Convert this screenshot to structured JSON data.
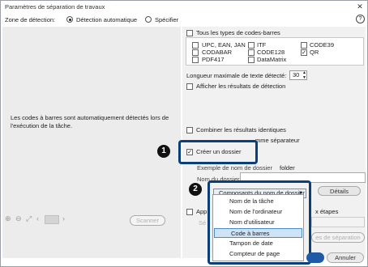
{
  "window": {
    "title": "Paramètres de séparation de travaux",
    "close_glyph": "✕",
    "help_glyph": "?"
  },
  "mode": {
    "label": "Zone de détection:",
    "options": [
      {
        "label": "Détection automatique",
        "selected": true
      },
      {
        "label": "Spécifier",
        "selected": false
      }
    ]
  },
  "left_pane": {
    "message": "Les codes à barres sont automatiquement détectés lors de l'exécution de la tâche.",
    "toolbar_icons": [
      "zoom-in-icon",
      "zoom-out-icon",
      "fit-icon",
      "prev-page-icon",
      "page-thumbnail-icon",
      "next-page-icon"
    ],
    "scan_button": "Scanner"
  },
  "barcodes": {
    "all_types_label": "Tous les types de codes-barres",
    "types": [
      {
        "label": "UPC, EAN, JAN",
        "checked": false
      },
      {
        "label": "ITF",
        "checked": false
      },
      {
        "label": "CODE39",
        "checked": false
      },
      {
        "label": "CODABAR",
        "checked": false
      },
      {
        "label": "CODE128",
        "checked": false
      },
      {
        "label": "QR",
        "checked": true
      },
      {
        "label": "PDF417",
        "checked": false
      },
      {
        "label": "DataMatrix",
        "checked": false
      }
    ]
  },
  "max_length": {
    "label": "Longueur maximale de texte détecté:",
    "value": "30"
  },
  "show_results_label": "Afficher les résultats de détection",
  "combine_label": "Combiner les résultats identiques",
  "separator_partial": "mme séparateur",
  "create_folder": {
    "label": "Créer un dossier",
    "checked": true
  },
  "folder_example": {
    "label": "Exemple de nom de dossier",
    "value": "folder"
  },
  "folder_name_partial": "Nom du dossier",
  "components_dropdown": {
    "label": "Composants du nom de dossier",
    "arrow": "▼"
  },
  "details_button": "Détails",
  "menu_items": [
    {
      "label": "Nom de la tâche",
      "selected": false
    },
    {
      "label": "Nom de l'ordinateur",
      "selected": false
    },
    {
      "label": "Nom d'utilisateur",
      "selected": false
    },
    {
      "label": "Code à barres",
      "selected": true
    },
    {
      "label": "Tampon de date",
      "selected": false
    },
    {
      "label": "Compteur de page",
      "selected": false
    }
  ],
  "bottom": {
    "app_partial": "App",
    "steps_partial": "x étapes",
    "se_partial": "Sé",
    "sep_button_partial": "es de séparation",
    "cancel_button": "Annuler"
  },
  "callout_badges": [
    "1",
    "2"
  ]
}
